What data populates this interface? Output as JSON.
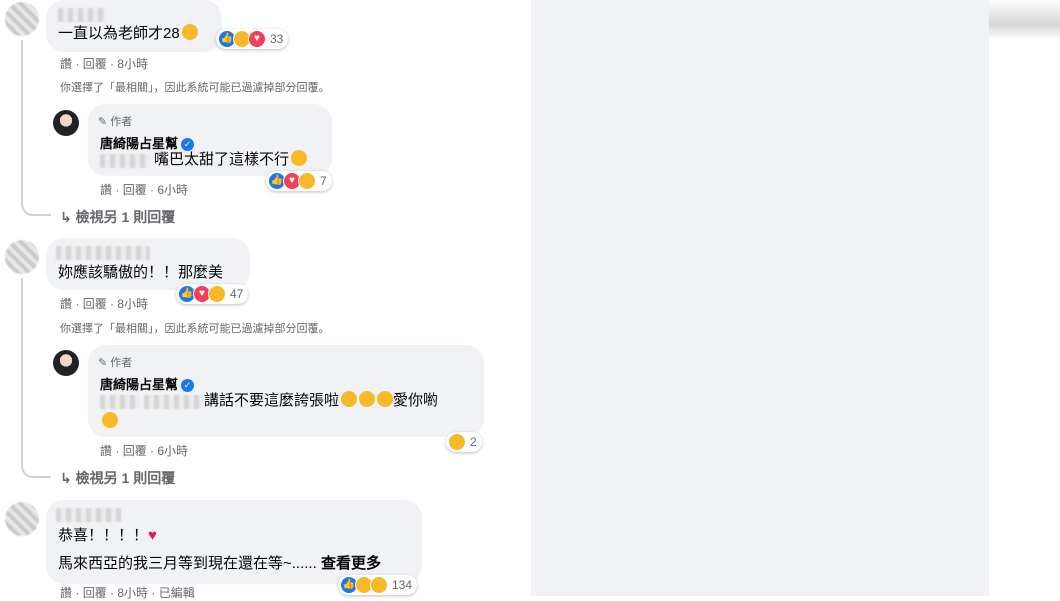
{
  "comments": [
    {
      "text": "一直以為老師才28",
      "reactions_count": "33",
      "actions": {
        "like": "讚",
        "reply": "回覆",
        "time": "8小時"
      },
      "filter_note": "你選擇了「最相關」，因此系統可能已過濾掉部分回覆。",
      "author_reply": {
        "tag": "作者",
        "name": "唐綺陽占星幫",
        "text": "嘴巴太甜了這樣不行",
        "reactions_count": "7",
        "actions": {
          "like": "讚",
          "reply": "回覆",
          "time": "6小時"
        }
      },
      "view_more": "檢視另 1 則回覆"
    },
    {
      "text": "妳應該驕傲的！！那麼美",
      "reactions_count": "47",
      "actions": {
        "like": "讚",
        "reply": "回覆",
        "time": "8小時"
      },
      "filter_note": "你選擇了「最相關」，因此系統可能已過濾掉部分回覆。",
      "author_reply": {
        "tag": "作者",
        "name": "唐綺陽占星幫",
        "text_line1": "講話不要這麼誇張啦",
        "text_love": "愛你喲",
        "reactions_count": "2",
        "actions": {
          "like": "讚",
          "reply": "回覆",
          "time": "6小時"
        }
      },
      "view_more": "檢視另 1 則回覆"
    },
    {
      "text_line1": "恭喜！！！！",
      "text_line2": "馬來西亞的我三月等到現在還在等~......",
      "see_more": "查看更多",
      "reactions_count": "134",
      "actions": {
        "like": "讚",
        "reply": "回覆",
        "time": "8小時",
        "edited": "已編輯"
      }
    }
  ],
  "icons": {
    "pencil": "pencil-icon",
    "verified": "verified-badge-icon",
    "reply_arrow": "reply-arrow-icon",
    "like": "like-reaction-icon",
    "haha": "haha-reaction-icon",
    "love": "love-reaction-icon"
  },
  "colors": {
    "bubble_bg": "#f0f2f5",
    "meta_text": "#65676b",
    "link_blue": "#1877f2"
  }
}
